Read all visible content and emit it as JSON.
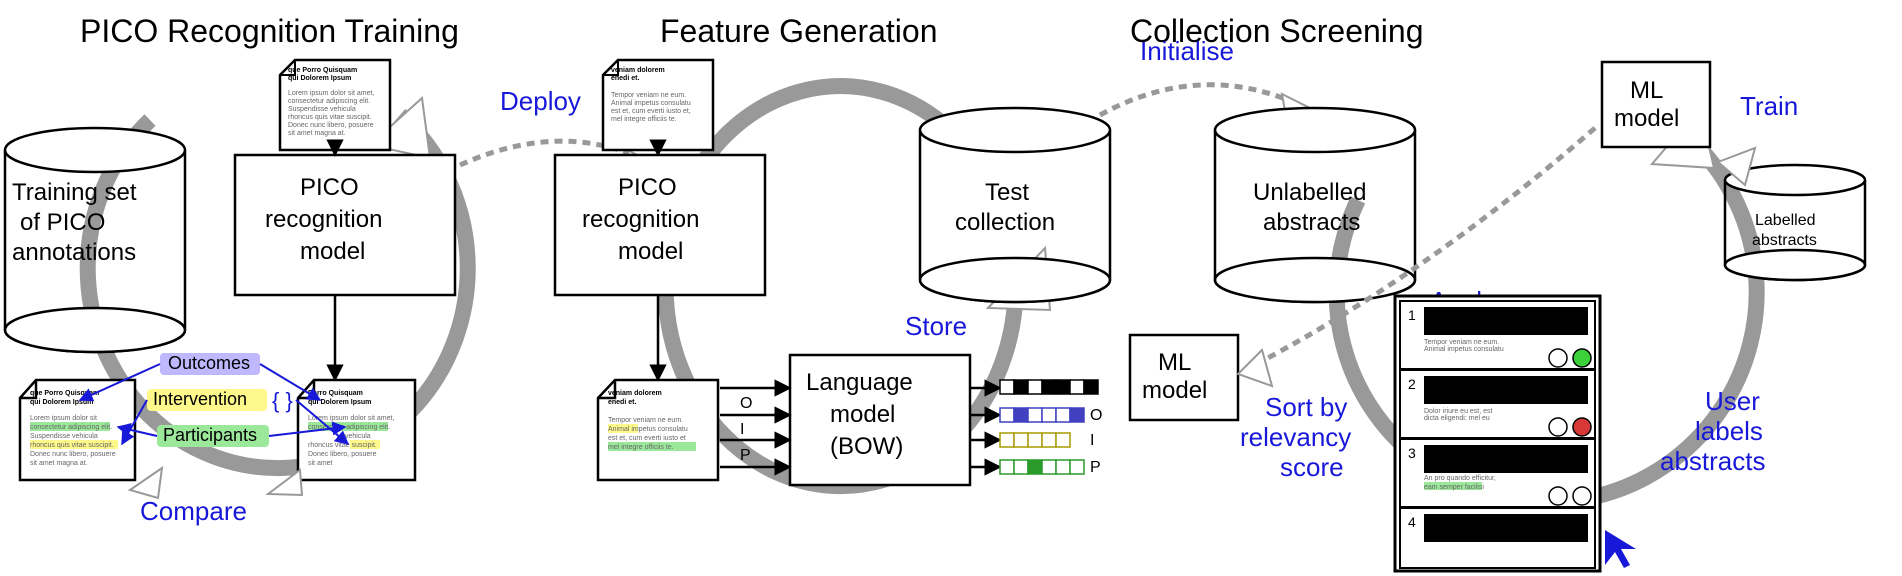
{
  "sections": {
    "training": "PICO Recognition Training",
    "feature": "Feature Generation",
    "screening": "Collection Screening"
  },
  "nodes": {
    "training_set": "Training set\nof PICO\nannotations",
    "pico_model_1": "PICO\nrecognition\nmodel",
    "pico_model_2": "PICO\nrecognition\nmodel",
    "test_collection": "Test\ncollection",
    "unlabelled": "Unlabelled\nabstracts",
    "labelled": "Labelled\nabstracts",
    "language_model": "Language\nmodel\n(BOW)",
    "ml_model_lower": "ML\nmodel",
    "ml_model_upper": "ML\nmodel"
  },
  "edges": {
    "compare": "Compare",
    "deploy": "Deploy",
    "store": "Store",
    "initialise": "Initialise",
    "apply": "Apply",
    "train": "Train",
    "sort": "Sort by\nrelevancy\nscore",
    "user_labels": "User\nlabels\nabstracts"
  },
  "tags": {
    "outcomes": "Outcomes",
    "intervention": "Intervention",
    "participants": "Participants"
  },
  "bow_labels": {
    "o": "O",
    "i": "I",
    "p": "P"
  },
  "braces": "{ }",
  "doc_phrases": {
    "title1": "que Porro Quisquam qui Dolorem Ipsum",
    "body1": "Lorem ipsum dolor sit amet, consectetur adipiscing elit. Suspendisse vehicula rhoncus quis vitae suscipit. Donec nunc libero, posuere sit amet magna at.",
    "title2": "veniam dolorem enedi et.",
    "body2": "Tempor veniam dolorem ne eum. Animal impetus consulatu est et, cum everti justo et, ne mel integre officiis te."
  }
}
